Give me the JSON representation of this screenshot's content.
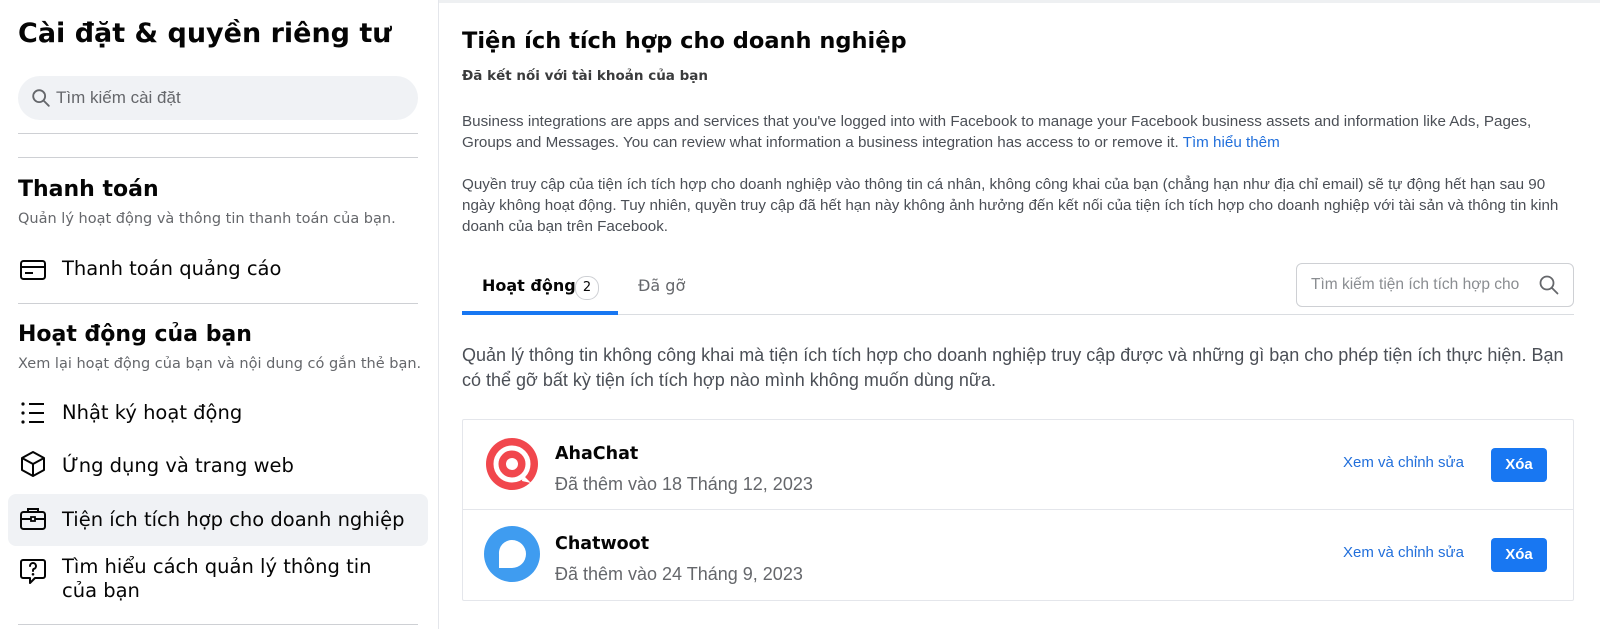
{
  "sidebar": {
    "title": "Cài đặt & quyền riêng tư",
    "search_placeholder": "Tìm kiếm cài đặt",
    "sections": [
      {
        "title": "Thanh toán",
        "subtitle": "Quản lý hoạt động và thông tin thanh toán của bạn.",
        "items": [
          {
            "label": "Thanh toán quảng cáo",
            "icon": "credit-card-icon"
          }
        ]
      },
      {
        "title": "Hoạt động của bạn",
        "subtitle": "Xem lại hoạt động của bạn và nội dung có gắn thẻ bạn.",
        "items": [
          {
            "label": "Nhật ký hoạt động",
            "icon": "list-icon"
          },
          {
            "label": "Ứng dụng và trang web",
            "icon": "cube-icon"
          },
          {
            "label": "Tiện ích tích hợp cho doanh nghiệp",
            "icon": "briefcase-icon",
            "active": true
          },
          {
            "label": "Tìm hiểu cách quản lý thông tin của bạn",
            "icon": "question-bubble-icon"
          }
        ]
      }
    ]
  },
  "main": {
    "title": "Tiện ích tích hợp cho doanh nghiệp",
    "subtitle": "Đã kết nối với tài khoản của bạn",
    "intro_text": "Business integrations are apps and services that you've logged into with Facebook to manage your Facebook business assets and information like Ads, Pages, Groups and Messages. You can review what information a business integration has access to or remove it.",
    "learn_more": "Tìm hiểu thêm",
    "expiry_text": "Quyền truy cập của tiện ích tích hợp cho doanh nghiệp vào thông tin cá nhân, không công khai của bạn (chẳng hạn như địa chỉ email) sẽ tự động hết hạn sau 90 ngày không hoạt động. Tuy nhiên, quyền truy cập đã hết hạn này không ảnh hưởng đến kết nối của tiện ích tích hợp cho doanh nghiệp với tài sản và thông tin kinh doanh của bạn trên Facebook.",
    "tabs": [
      {
        "label": "Hoạt động",
        "count": "2",
        "active": true
      },
      {
        "label": "Đã gỡ",
        "active": false
      }
    ],
    "search_placeholder": "Tìm kiếm tiện ích tích hợp cho",
    "management_text": "Quản lý thông tin không công khai mà tiện ích tích hợp cho doanh nghiệp truy cập được và những gì bạn cho phép tiện ích thực hiện. Bạn có thể gỡ bất kỳ tiện ích tích hợp nào mình không muốn dùng nữa.",
    "integrations": [
      {
        "name": "AhaChat",
        "added": "Đã thêm vào 18 Tháng 12, 2023",
        "edit_label": "Xem và chỉnh sửa",
        "remove_label": "Xóa",
        "icon_color": "#f1474d"
      },
      {
        "name": "Chatwoot",
        "added": "Đã thêm vào 24 Tháng 9, 2023",
        "edit_label": "Xem và chỉnh sửa",
        "remove_label": "Xóa",
        "icon_color": "#3f9cf0"
      }
    ]
  },
  "colors": {
    "accent": "#1877f2",
    "link": "#216fdb",
    "active_item_bg": "#f0f2f5"
  }
}
